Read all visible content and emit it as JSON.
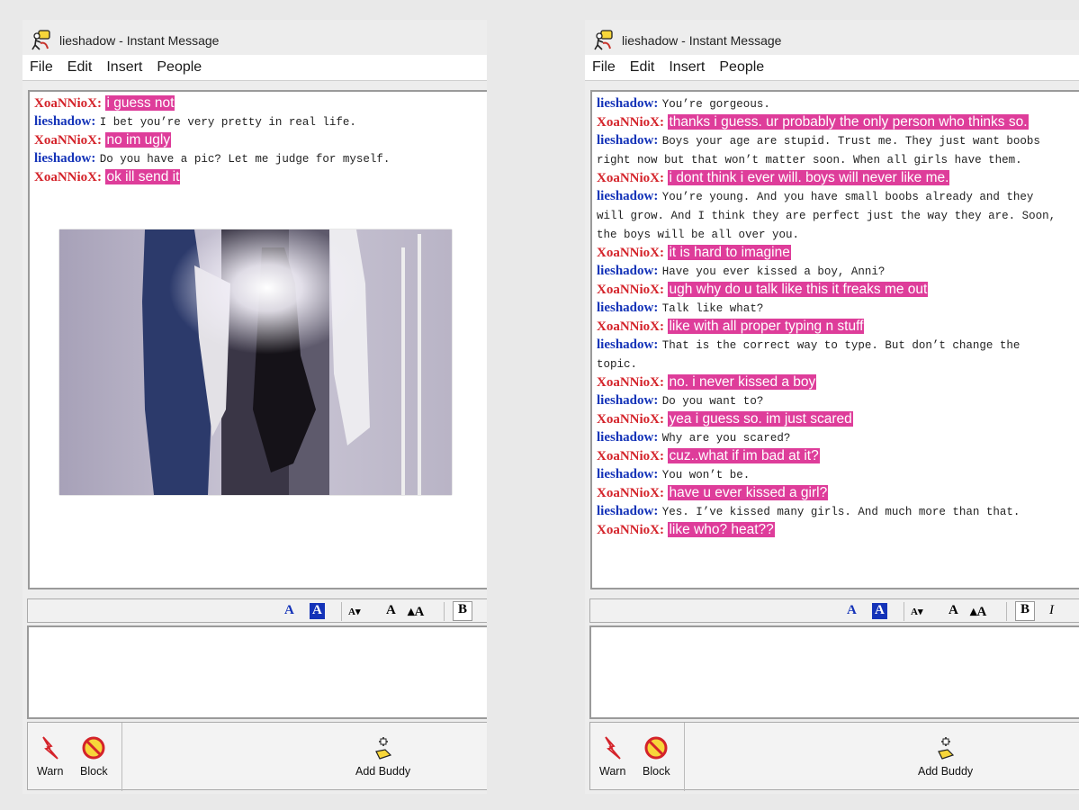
{
  "windows": [
    {
      "id": "left",
      "title": "lieshadow - Instant Message",
      "menu": [
        "File",
        "Edit",
        "Insert",
        "People"
      ],
      "messages": [
        {
          "sender": "XoaNNioX:",
          "color": "red",
          "text": "i guess not"
        },
        {
          "sender": "lieshadow:",
          "color": "blue",
          "text": "I bet you’re very pretty in real life."
        },
        {
          "sender": "XoaNNioX:",
          "color": "red",
          "text": "no im ugly"
        },
        {
          "sender": "lieshadow:",
          "color": "blue",
          "text": "Do you have a pic? Let me judge for myself."
        },
        {
          "sender": "XoaNNioX:",
          "color": "red",
          "text": "ok ill send it"
        }
      ],
      "bottom": {
        "warn": "Warn",
        "block": "Block",
        "add_buddy": "Add Buddy"
      }
    },
    {
      "id": "right",
      "title": "lieshadow - Instant Message",
      "menu": [
        "File",
        "Edit",
        "Insert",
        "People"
      ],
      "messages": [
        {
          "sender": "lieshadow:",
          "color": "blue",
          "text": "You’re gorgeous."
        },
        {
          "sender": "XoaNNioX:",
          "color": "red",
          "text": "thanks i guess. ur probably the only person who thinks so."
        },
        {
          "sender": "lieshadow:",
          "color": "blue",
          "text": "Boys your age are stupid. Trust me. They just want boobs right now but that won’t matter soon. When all girls have them."
        },
        {
          "sender": "XoaNNioX:",
          "color": "red",
          "text": "i dont think i ever will. boys will never like me."
        },
        {
          "sender": "lieshadow:",
          "color": "blue",
          "text": "You’re young. And you have small boobs already and they will grow. And I think they are perfect just the way they are. Soon, the boys will be all over you."
        },
        {
          "sender": "XoaNNioX:",
          "color": "red",
          "text": "it is hard to imagine"
        },
        {
          "sender": "lieshadow:",
          "color": "blue",
          "text": "Have you ever kissed a boy, Anni?"
        },
        {
          "sender": "XoaNNioX:",
          "color": "red",
          "text": "ugh why do u talk like this it freaks me out"
        },
        {
          "sender": "lieshadow:",
          "color": "blue",
          "text": "Talk like what?"
        },
        {
          "sender": "XoaNNioX:",
          "color": "red",
          "text": "like with all proper typing n stuff"
        },
        {
          "sender": "lieshadow:",
          "color": "blue",
          "text": "That is the correct way to type. But don’t change the topic."
        },
        {
          "sender": "XoaNNioX:",
          "color": "red",
          "text": "no. i never kissed a boy"
        },
        {
          "sender": "lieshadow:",
          "color": "blue",
          "text": "Do you want to?"
        },
        {
          "sender": "XoaNNioX:",
          "color": "red",
          "text": "yea i guess so. im just scared"
        },
        {
          "sender": "lieshadow:",
          "color": "blue",
          "text": "Why are you scared?"
        },
        {
          "sender": "XoaNNioX:",
          "color": "red",
          "text": "cuz..what if im bad at it?"
        },
        {
          "sender": "lieshadow:",
          "color": "blue",
          "text": "You won’t be."
        },
        {
          "sender": "XoaNNioX:",
          "color": "red",
          "text": "have u ever kissed a girl?"
        },
        {
          "sender": "lieshadow:",
          "color": "blue",
          "text": "Yes. I’ve kissed many girls. And much more than that."
        },
        {
          "sender": "XoaNNioX:",
          "color": "red",
          "text": "like who? heat??"
        }
      ],
      "bottom": {
        "warn": "Warn",
        "block": "Block",
        "add_buddy": "Add Buddy"
      }
    }
  ],
  "colors": {
    "highlight": "#de3d9a",
    "screen_name_red": "#d4232a",
    "screen_name_blue": "#1433b8"
  }
}
